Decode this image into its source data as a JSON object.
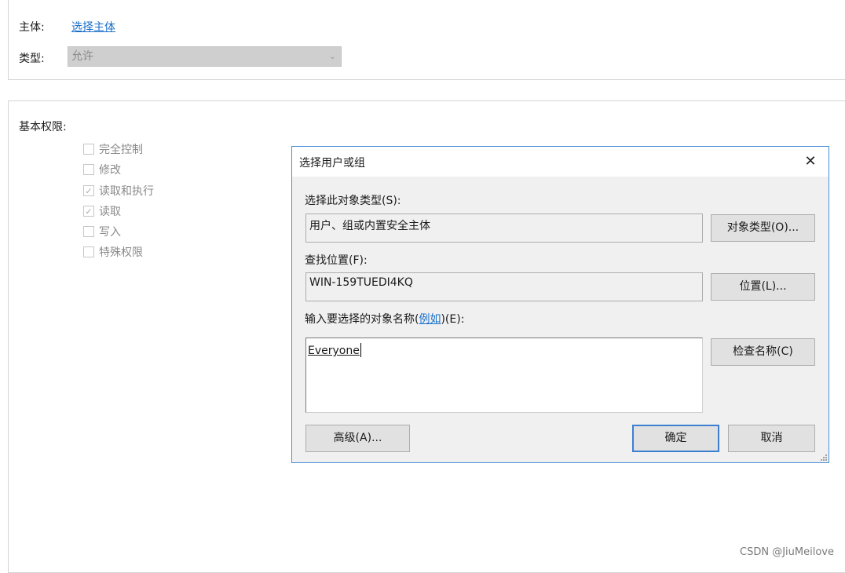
{
  "principal": {
    "label": "主体:",
    "link": "选择主体"
  },
  "type": {
    "label": "类型:",
    "value": "允许"
  },
  "basic_permissions": {
    "heading": "基本权限:",
    "items": [
      {
        "label": "完全控制",
        "checked": false
      },
      {
        "label": "修改",
        "checked": false
      },
      {
        "label": "读取和执行",
        "checked": true
      },
      {
        "label": "读取",
        "checked": true
      },
      {
        "label": "写入",
        "checked": false
      },
      {
        "label": "特殊权限",
        "checked": false
      }
    ]
  },
  "dialog": {
    "title": "选择用户或组",
    "object_type_label": "选择此对象类型(S):",
    "object_type_value": "用户、组或内置安全主体",
    "object_types_button": "对象类型(O)...",
    "location_label": "查找位置(F):",
    "location_value": "WIN-159TUEDI4KQ",
    "location_button": "位置(L)...",
    "names_label_prefix": "输入要选择的对象名称(",
    "names_label_link": "例如",
    "names_label_suffix": ")(E):",
    "names_value": "Everyone",
    "check_names_button": "检查名称(C)",
    "advanced_button": "高级(A)...",
    "ok_button": "确定",
    "cancel_button": "取消"
  },
  "watermark": "CSDN @JiuMeilove",
  "colors": {
    "accent": "#1a6fc9",
    "dialog_border": "#4a8fd9",
    "dialog_bg": "#f0f0f0"
  }
}
